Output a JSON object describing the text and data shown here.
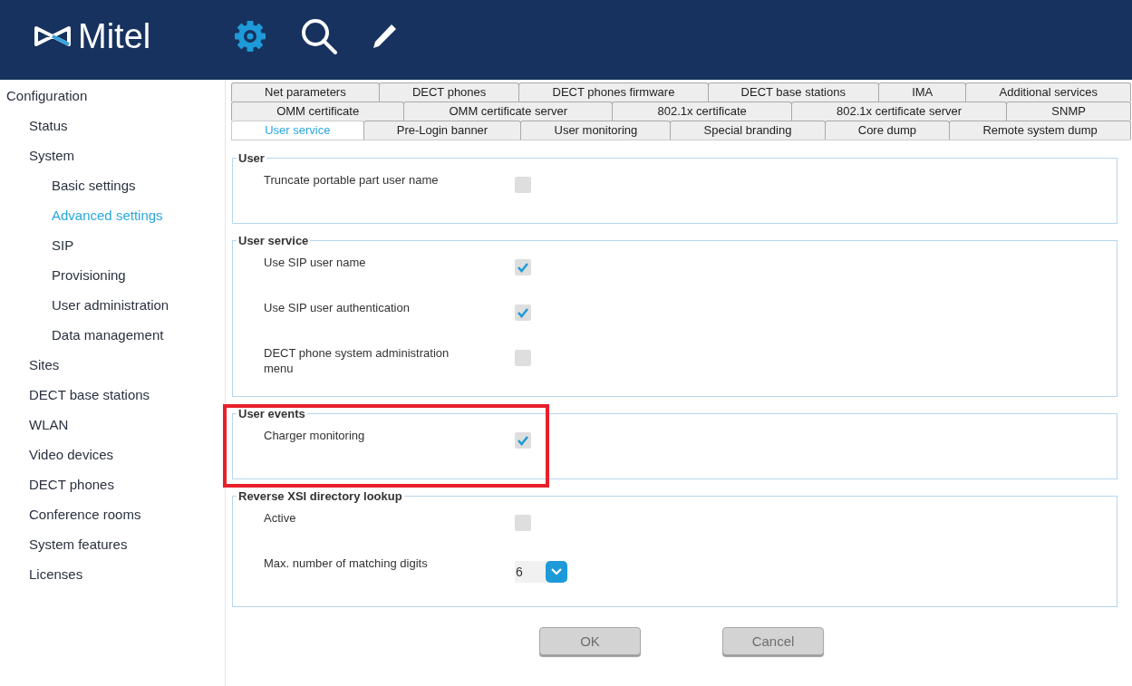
{
  "header": {
    "logo": "Mitel",
    "toolbar": [
      {
        "kind": "settings",
        "selected": true
      },
      {
        "kind": "search",
        "selected": false
      },
      {
        "kind": "edit",
        "selected": false
      }
    ]
  },
  "sidebar": {
    "items": [
      {
        "label": "Configuration",
        "selected": false,
        "children": [
          {
            "label": "Status",
            "selected": false
          },
          {
            "label": "System",
            "selected": false,
            "children": [
              {
                "label": "Basic settings",
                "selected": false
              },
              {
                "label": "Advanced settings",
                "selected": true
              },
              {
                "label": "SIP",
                "selected": false
              },
              {
                "label": "Provisioning",
                "selected": false
              },
              {
                "label": "User administration",
                "selected": false
              },
              {
                "label": "Data management",
                "selected": false
              }
            ]
          },
          {
            "label": "Sites",
            "selected": false
          },
          {
            "label": "DECT base stations",
            "selected": false
          },
          {
            "label": "WLAN",
            "selected": false
          },
          {
            "label": "Video devices",
            "selected": false
          },
          {
            "label": "DECT phones",
            "selected": false
          },
          {
            "label": "Conference rooms",
            "selected": false
          },
          {
            "label": "System features",
            "selected": false
          },
          {
            "label": "Licenses",
            "selected": false
          }
        ]
      }
    ]
  },
  "tab_rows": [
    [
      {
        "label": "Net parameters",
        "selected": false
      },
      {
        "label": "DECT phones",
        "selected": false
      },
      {
        "label": "DECT phones firmware",
        "selected": false
      },
      {
        "label": "DECT base stations",
        "selected": false
      },
      {
        "label": "IMA",
        "selected": false
      },
      {
        "label": "Additional services",
        "selected": false
      }
    ],
    [
      {
        "label": "OMM certificate",
        "selected": false
      },
      {
        "label": "OMM certificate server",
        "selected": false
      },
      {
        "label": "802.1x certificate",
        "selected": false
      },
      {
        "label": "802.1x certificate server",
        "selected": false
      },
      {
        "label": "SNMP",
        "selected": false
      }
    ],
    [
      {
        "label": "User service",
        "selected": true
      },
      {
        "label": "Pre-Login banner",
        "selected": false
      },
      {
        "label": "User monitoring",
        "selected": false
      },
      {
        "label": "Special branding",
        "selected": false
      },
      {
        "label": "Core dump",
        "selected": false
      },
      {
        "label": "Remote system dump",
        "selected": false
      }
    ]
  ],
  "sections": [
    {
      "title": "User",
      "highlighted": false,
      "rows": [
        {
          "kind": "checkbox",
          "label": "Truncate portable part user name",
          "checked": false
        }
      ]
    },
    {
      "title": "User service",
      "highlighted": false,
      "rows": [
        {
          "kind": "checkbox",
          "label": "Use SIP user name",
          "checked": true
        },
        {
          "kind": "checkbox",
          "label": "Use SIP user authentication",
          "checked": true
        },
        {
          "kind": "checkbox",
          "label": "DECT phone system administration menu",
          "checked": false
        }
      ]
    },
    {
      "title": "User events",
      "highlighted": true,
      "rows": [
        {
          "kind": "checkbox",
          "label": "Charger monitoring",
          "checked": true
        }
      ]
    },
    {
      "title": "Reverse XSI directory lookup",
      "highlighted": false,
      "rows": [
        {
          "kind": "checkbox",
          "label": "Active",
          "checked": false
        },
        {
          "kind": "select",
          "label": "Max. number of matching digits",
          "value": "6"
        }
      ]
    }
  ],
  "buttons": [
    {
      "label": "OK",
      "disabled": true
    },
    {
      "label": "Cancel",
      "disabled": true
    }
  ]
}
